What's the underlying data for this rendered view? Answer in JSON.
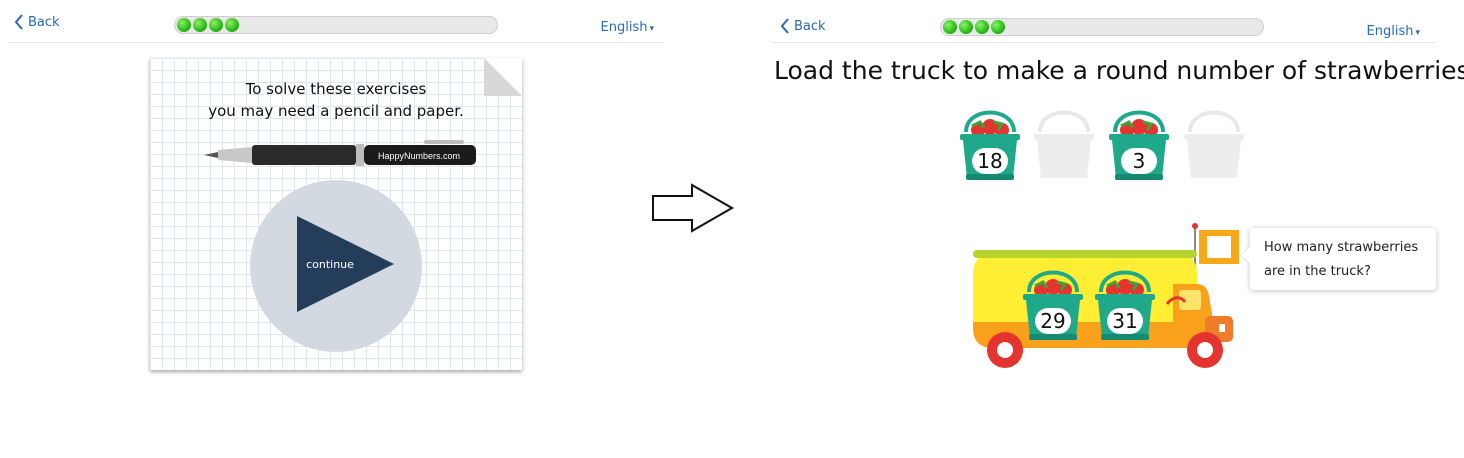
{
  "left_screen": {
    "back_label": "Back",
    "language": "English",
    "progress_dots": 4,
    "instruction_line1": "To solve these exercises",
    "instruction_line2": "you may need a pencil and paper.",
    "pen_brand": "HappyNumbers.com",
    "continue_label": "continue"
  },
  "right_screen": {
    "back_label": "Back",
    "language": "English",
    "progress_dots": 4,
    "title": "Load the truck to make a round number of strawberries",
    "baskets": [
      {
        "value": "18",
        "filled": true
      },
      {
        "value": "",
        "filled": false
      },
      {
        "value": "3",
        "filled": true
      },
      {
        "value": "",
        "filled": false
      }
    ],
    "truck_baskets": [
      "29",
      "31"
    ],
    "question_line1": "How many strawberries",
    "question_line2": "are in the truck?"
  },
  "colors": {
    "link_blue": "#2a6ab0",
    "progress_green": "#2fc01b",
    "play_triangle": "#233d5a",
    "basket_teal": "#1fa98a",
    "truck_yellow": "#ffee33"
  }
}
